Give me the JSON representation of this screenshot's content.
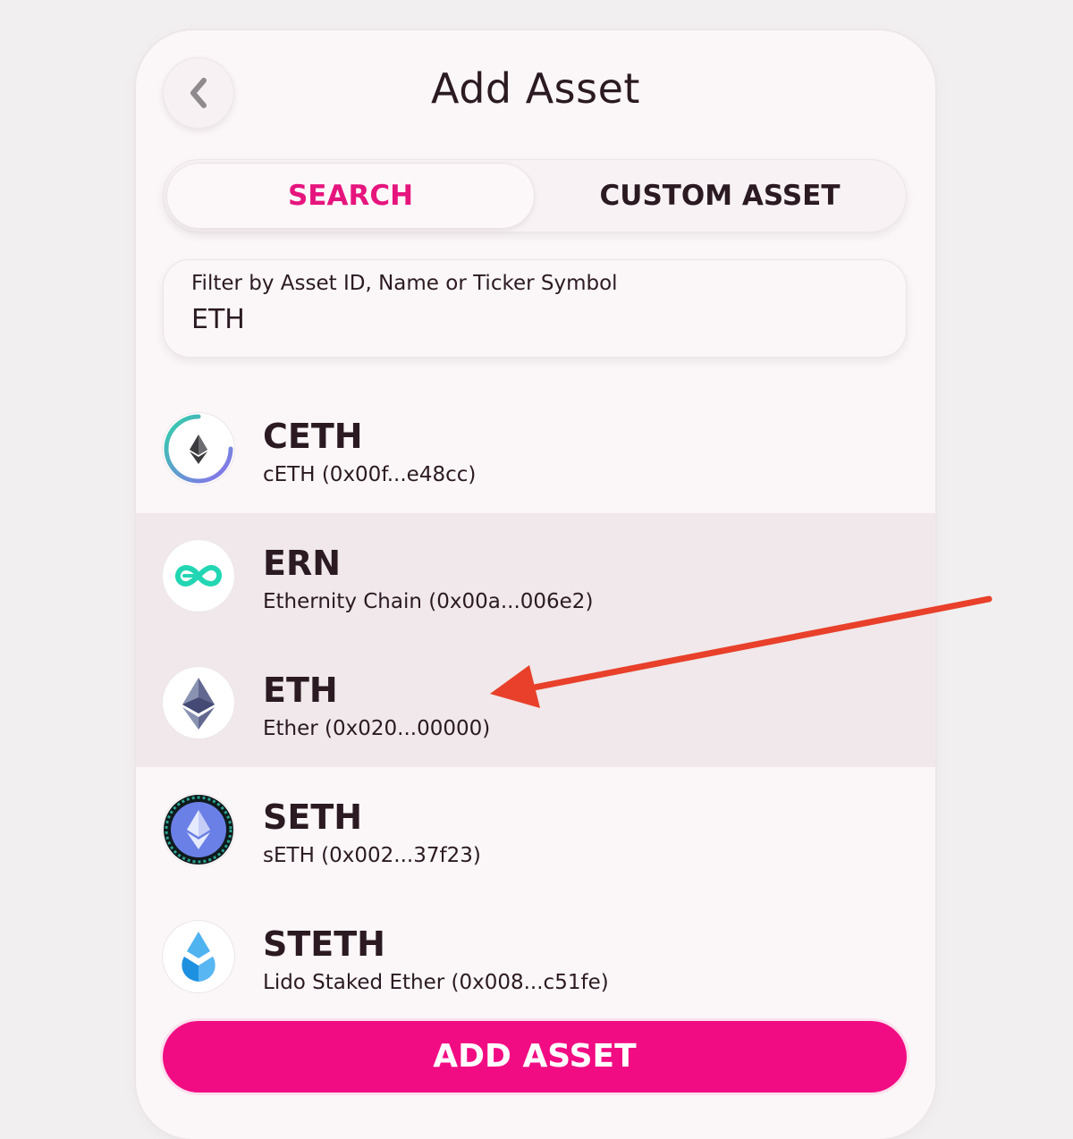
{
  "header": {
    "title": "Add Asset",
    "back_icon": "chevron-left-icon"
  },
  "tabs": [
    {
      "label": "SEARCH",
      "active": true
    },
    {
      "label": "CUSTOM ASSET",
      "active": false
    }
  ],
  "search": {
    "label": "Filter by Asset ID, Name or Ticker Symbol",
    "value": "ETH"
  },
  "assets": [
    {
      "ticker": "CETH",
      "subtitle": "cETH (0x00f...e48cc)",
      "icon": "ceth-icon",
      "highlighted": false
    },
    {
      "ticker": "ERN",
      "subtitle": "Ethernity Chain (0x00a...006e2)",
      "icon": "ern-icon",
      "highlighted": true
    },
    {
      "ticker": "ETH",
      "subtitle": "Ether (0x020...00000)",
      "icon": "eth-icon",
      "highlighted": true
    },
    {
      "ticker": "SETH",
      "subtitle": "sETH (0x002...37f23)",
      "icon": "seth-icon",
      "highlighted": false
    },
    {
      "ticker": "STETH",
      "subtitle": "Lido Staked Ether (0x008...c51fe)",
      "icon": "steth-icon",
      "highlighted": false
    }
  ],
  "footer": {
    "add_label": "ADD ASSET"
  },
  "colors": {
    "accent": "#e6157e",
    "button": "#f20c83",
    "highlight_row": "#f0e8ea",
    "annotation_arrow": "#e8402a"
  }
}
